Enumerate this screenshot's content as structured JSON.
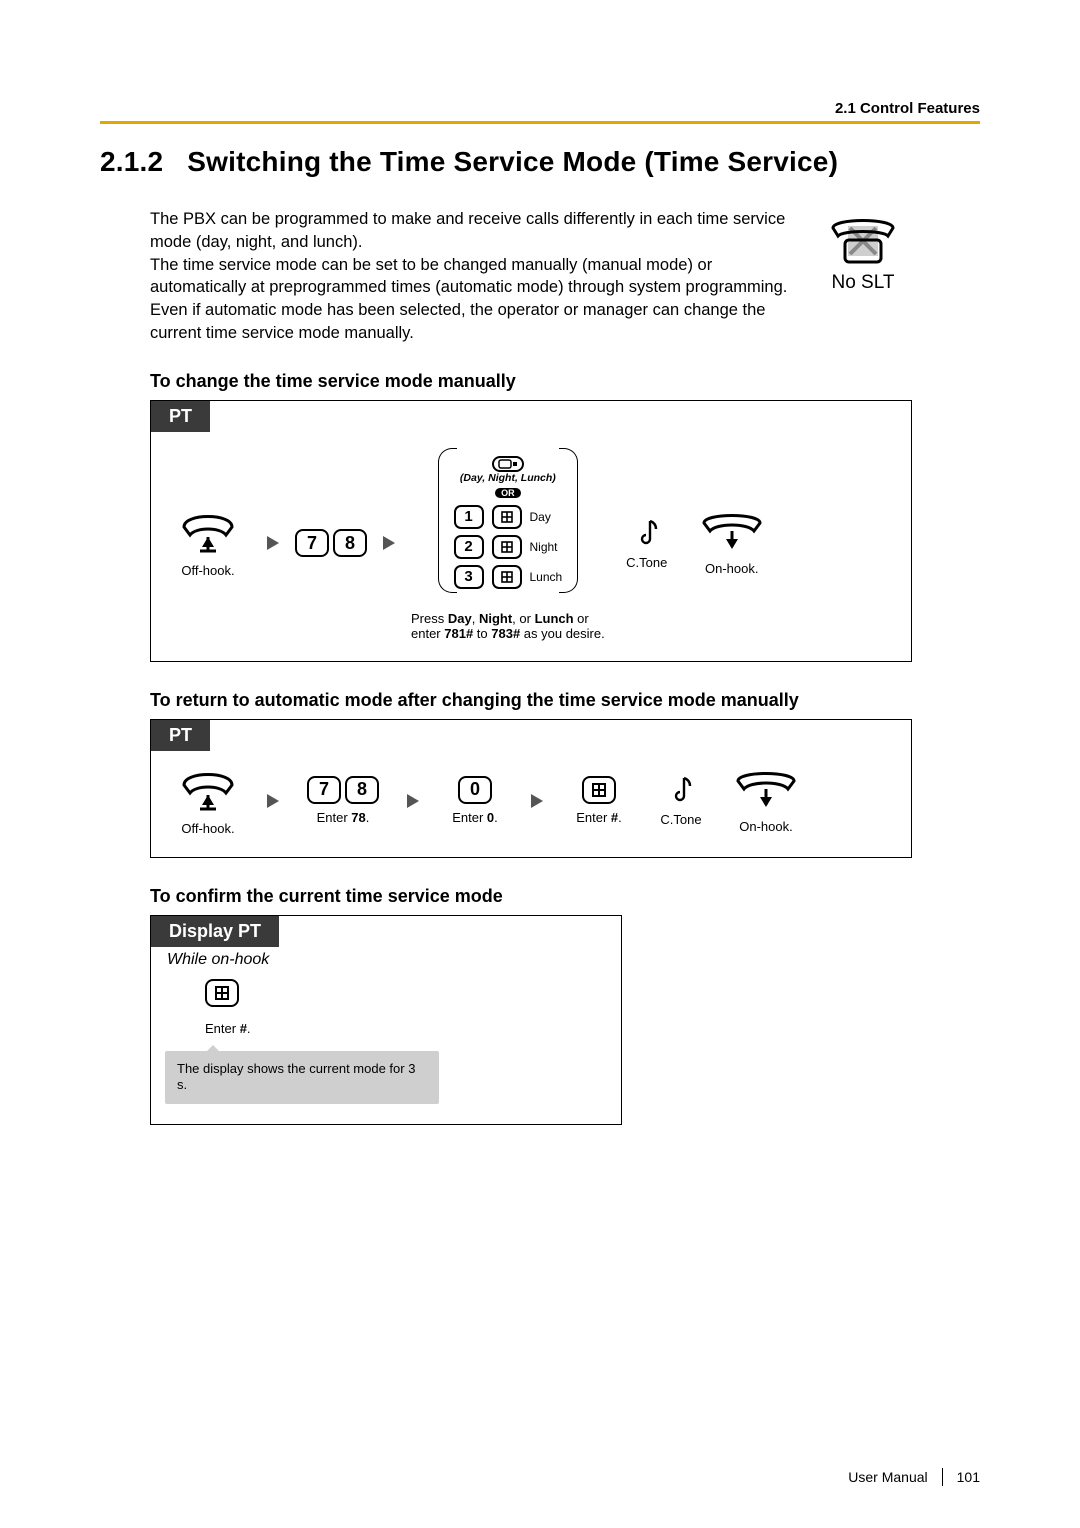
{
  "header": {
    "breadcrumb": "2.1 Control Features"
  },
  "title": {
    "number": "2.1.2",
    "text": "Switching the Time Service Mode (Time Service)"
  },
  "intro": {
    "p1": "The PBX can be programmed to make and receive calls differently in each time service mode (day, night, and lunch).",
    "p2": "The time service mode can be set to be changed manually (manual mode) or automatically at preprogrammed times (automatic mode) through system programming. Even if automatic mode has been selected, the operator or manager can change the current time service mode manually."
  },
  "no_slt_label": "No SLT",
  "sub1": "To change the time service mode manually",
  "proc1": {
    "tab": "PT",
    "offhook": "Off-hook.",
    "keys78": [
      "7",
      "8"
    ],
    "opt_header_italic": "(Day, Night, Lunch)",
    "opt_header_or": "OR",
    "rows": [
      {
        "digit": "1",
        "label": "Day"
      },
      {
        "digit": "2",
        "label": "Night"
      },
      {
        "digit": "3",
        "label": "Lunch"
      }
    ],
    "desc_parts": {
      "a": "Press ",
      "b": "Day",
      "c": ", ",
      "d": "Night",
      "e": ", or ",
      "f": "Lunch",
      "g": " or",
      "h": "enter ",
      "i": "781#",
      "j": " to ",
      "k": "783#",
      "l": " as you desire."
    },
    "ctone": "C.Tone",
    "onhook": "On-hook."
  },
  "sub2": "To return to automatic mode after changing the time service mode manually",
  "proc2": {
    "tab": "PT",
    "offhook": "Off-hook.",
    "keys78": [
      "7",
      "8"
    ],
    "desc78_a": "Enter ",
    "desc78_b": "78",
    "desc78_c": ".",
    "key0": "0",
    "desc0_a": "Enter ",
    "desc0_b": "0",
    "desc0_c": ".",
    "deschash_a": "Enter ",
    "deschash_b": "#",
    "deschash_c": ".",
    "ctone": "C.Tone",
    "onhook": "On-hook."
  },
  "sub3": "To confirm the current time service mode",
  "proc3": {
    "tab": "Display PT",
    "while": "While on-hook",
    "deschash_a": "Enter ",
    "deschash_b": "#",
    "deschash_c": ".",
    "bubble": "The display shows the current mode for 3 s."
  },
  "footer": {
    "manual": "User Manual",
    "page": "101"
  }
}
